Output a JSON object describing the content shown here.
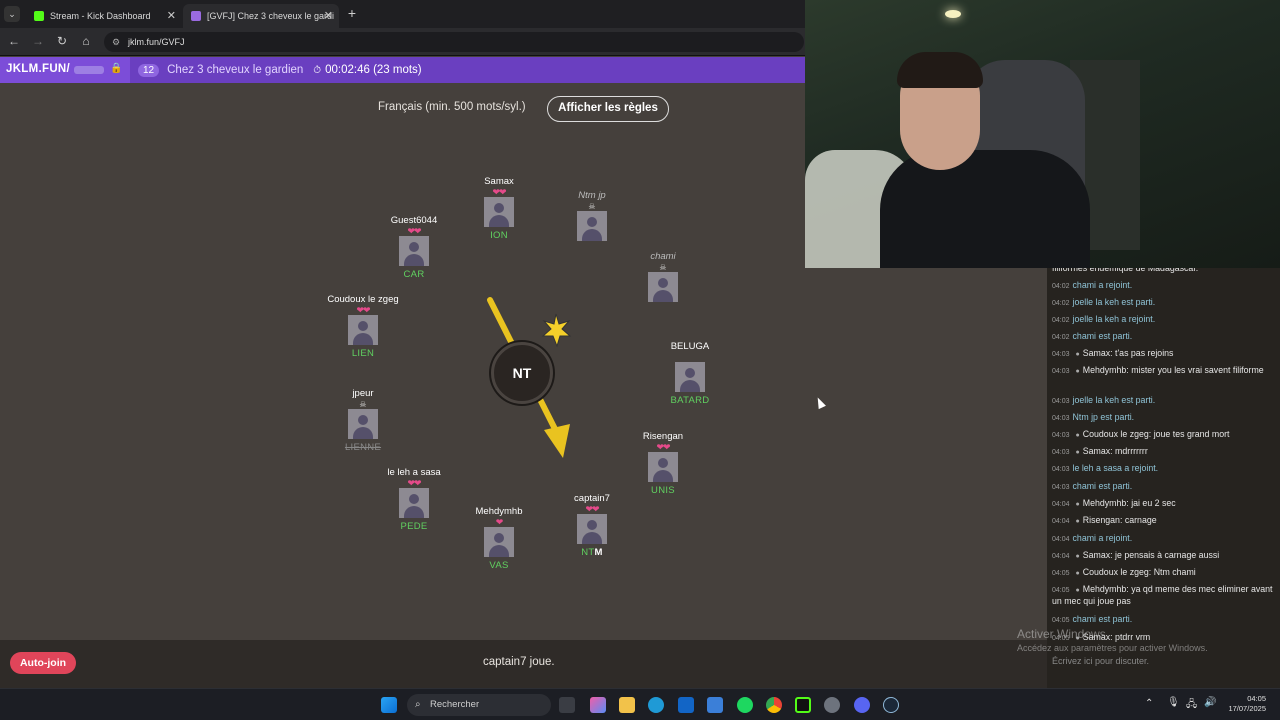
{
  "browser": {
    "tabs": [
      {
        "title": "Stream - Kick Dashboard",
        "active": false
      },
      {
        "title": "[GVFJ] Chez 3 cheveux le gardi",
        "active": true
      }
    ],
    "url": "jklm.fun/GVFJ"
  },
  "game": {
    "brand": "JKLM.FUN/",
    "player_count": "12",
    "room_name": "Chez 3 cheveux le gardien",
    "timer": "00:02:46 (23 mots)",
    "rules_text": "Français (min. 500 mots/syl.)",
    "rules_button": "Afficher les règles",
    "bomb_syllable": "NT",
    "turn_text": "captain7 joue.",
    "autojoin_label": "Auto-join",
    "players": [
      {
        "name": "Samax",
        "hearts": "❤❤",
        "word": "ION",
        "dead": false
      },
      {
        "name": "Ntm jp",
        "hearts": "",
        "word": "",
        "dead": true
      },
      {
        "name": "chami",
        "hearts": "",
        "word": "",
        "dead": true
      },
      {
        "name": "BELUGA",
        "hearts": "",
        "word": "BATARD",
        "dead": false
      },
      {
        "name": "Risengan",
        "hearts": "❤❤",
        "word": "UNIS",
        "dead": false
      },
      {
        "name": "captain7",
        "hearts": "❤❤",
        "word_a": "NT",
        "word_b": "M",
        "dead": false
      },
      {
        "name": "Mehdymhb",
        "hearts": "❤",
        "word": "VAS",
        "dead": false
      },
      {
        "name": "le leh a sasa",
        "hearts": "❤❤",
        "word": "PEDE",
        "dead": false
      },
      {
        "name": "jpeur",
        "hearts": "",
        "word": "LIENNE",
        "dead": true
      },
      {
        "name": "Coudoux le zgeg",
        "hearts": "❤❤",
        "word": "LIEN",
        "dead": false
      },
      {
        "name": "Guest6044",
        "hearts": "❤❤",
        "word": "CAR",
        "dead": false
      }
    ]
  },
  "chat": {
    "messages": [
      {
        "time": "",
        "user": "",
        "text": "filiformes endémique de Madagascar.",
        "system": false
      },
      {
        "time": "04:02",
        "user": "",
        "text": "chami a rejoint.",
        "system": true
      },
      {
        "time": "04:02",
        "user": "",
        "text": "joelle la keh est parti.",
        "system": true
      },
      {
        "time": "04:02",
        "user": "",
        "text": "joelle la keh a rejoint.",
        "system": true
      },
      {
        "time": "04:02",
        "user": "",
        "text": "chami est parti.",
        "system": true
      },
      {
        "time": "04:03",
        "user": "Samax",
        "text": "t'as pas rejoins",
        "system": false
      },
      {
        "time": "04:03",
        "user": "Mehdymhb",
        "text": "mister you les vrai savent filiforme",
        "system": false
      },
      {
        "time": "04:03",
        "user": "",
        "text": "joelle la keh est parti.",
        "system": true
      },
      {
        "time": "04:03",
        "user": "",
        "text": "Ntm jp est parti.",
        "system": true
      },
      {
        "time": "04:03",
        "user": "Coudoux le zgeg",
        "text": "joue tes grand mort",
        "system": false
      },
      {
        "time": "04:03",
        "user": "Samax",
        "text": "mdrrrrrrr",
        "system": false
      },
      {
        "time": "04:03",
        "user": "",
        "text": "le leh a sasa a rejoint.",
        "system": true
      },
      {
        "time": "04:03",
        "user": "",
        "text": "chami est parti.",
        "system": true
      },
      {
        "time": "04:04",
        "user": "Mehdymhb",
        "text": "jai eu 2 sec",
        "system": false
      },
      {
        "time": "04:04",
        "user": "Risengan",
        "text": "carnage",
        "system": false
      },
      {
        "time": "04:04",
        "user": "",
        "text": "chami a rejoint.",
        "system": true
      },
      {
        "time": "04:04",
        "user": "Samax",
        "text": "je pensais à carnage aussi",
        "system": false
      },
      {
        "time": "04:05",
        "user": "Coudoux le zgeg",
        "text": "Ntm chami",
        "system": false
      },
      {
        "time": "04:05",
        "user": "Mehdymhb",
        "text": "ya qd meme des mec eliminer avant un mec qui joue pas",
        "system": false
      },
      {
        "time": "04:05",
        "user": "",
        "text": "chami est parti.",
        "system": true
      },
      {
        "time": "04:05",
        "user": "Samax",
        "text": "ptdrr vrm",
        "system": false
      }
    ],
    "input_placeholder": "Écrivez ici pour discuter."
  },
  "watermark": {
    "line1": "Activer Windows",
    "line2": "Accédez aux paramètres pour activer Windows."
  },
  "taskbar": {
    "search_placeholder": "Rechercher",
    "time": "04:05",
    "date": "17/07/2025"
  },
  "colors": {
    "purple": "#7c4dd8",
    "heart": "#e54a8a",
    "word_green": "#60d060",
    "autojoin": "#e0455a"
  }
}
